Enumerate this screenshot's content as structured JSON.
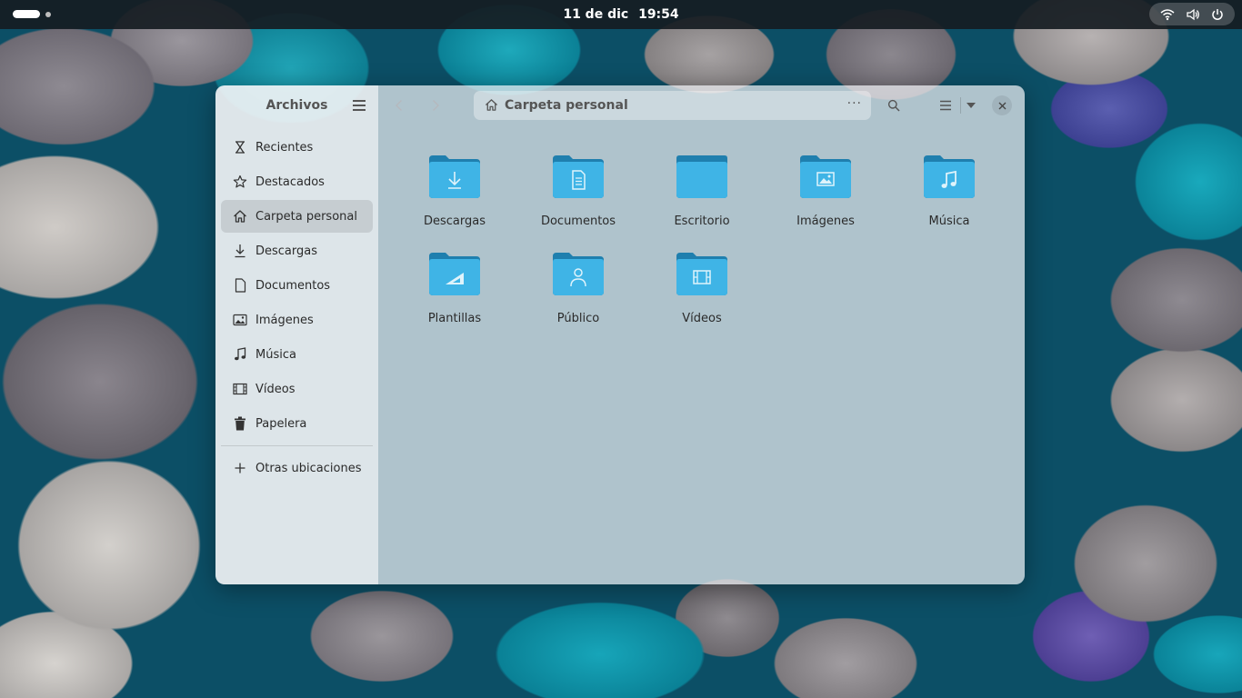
{
  "topbar": {
    "date": "11 de dic",
    "time": "19:54",
    "status_icons": [
      "wifi-icon",
      "volume-icon",
      "power-icon"
    ]
  },
  "sidebar": {
    "title": "Archivos",
    "places": [
      {
        "label": "Recientes",
        "icon": "clock-icon",
        "active": false
      },
      {
        "label": "Destacados",
        "icon": "star-icon",
        "active": false
      },
      {
        "label": "Carpeta personal",
        "icon": "home-icon",
        "active": true
      },
      {
        "label": "Descargas",
        "icon": "download-icon",
        "active": false
      },
      {
        "label": "Documentos",
        "icon": "document-icon",
        "active": false
      },
      {
        "label": "Imágenes",
        "icon": "image-icon",
        "active": false
      },
      {
        "label": "Música",
        "icon": "music-icon",
        "active": false
      },
      {
        "label": "Vídeos",
        "icon": "video-icon",
        "active": false
      },
      {
        "label": "Papelera",
        "icon": "trash-icon",
        "active": false
      }
    ],
    "other_locations": "Otras ubicaciones"
  },
  "header": {
    "path_label": "Carpeta personal"
  },
  "folders": [
    {
      "label": "Descargas",
      "emblem": "download"
    },
    {
      "label": "Documentos",
      "emblem": "document"
    },
    {
      "label": "Escritorio",
      "emblem": "desktop"
    },
    {
      "label": "Imágenes",
      "emblem": "image"
    },
    {
      "label": "Música",
      "emblem": "music"
    },
    {
      "label": "Plantillas",
      "emblem": "template"
    },
    {
      "label": "Público",
      "emblem": "person"
    },
    {
      "label": "Vídeos",
      "emblem": "video"
    }
  ],
  "colors": {
    "folder_front": "#3fb4e6",
    "folder_back": "#1f7fae",
    "accent": "#2a9fd6"
  }
}
